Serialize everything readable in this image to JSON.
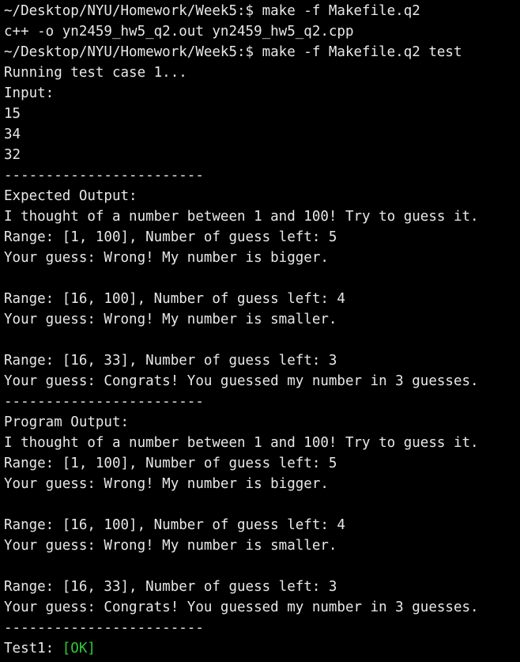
{
  "terminal": {
    "lines": [
      "~/Desktop/NYU/Homework/Week5:$ make -f Makefile.q2",
      "c++ -o yn2459_hw5_q2.out yn2459_hw5_q2.cpp",
      "~/Desktop/NYU/Homework/Week5:$ make -f Makefile.q2 test",
      "Running test case 1...",
      "Input:",
      "15",
      "34",
      "32",
      "------------------------",
      "Expected Output:",
      "I thought of a number between 1 and 100! Try to guess it.",
      "Range: [1, 100], Number of guess left: 5",
      "Your guess: Wrong! My number is bigger.",
      "",
      "Range: [16, 100], Number of guess left: 4",
      "Your guess: Wrong! My number is smaller.",
      "",
      "Range: [16, 33], Number of guess left: 3",
      "Your guess: Congrats! You guessed my number in 3 guesses.",
      "------------------------",
      "Program Output:",
      "I thought of a number between 1 and 100! Try to guess it.",
      "Range: [1, 100], Number of guess left: 5",
      "Your guess: Wrong! My number is bigger.",
      "",
      "Range: [16, 100], Number of guess left: 4",
      "Your guess: Wrong! My number is smaller.",
      "",
      "Range: [16, 33], Number of guess left: 3",
      "Your guess: Congrats! You guessed my number in 3 guesses.",
      "------------------------"
    ],
    "final_line": {
      "prefix": "Test1: ",
      "status": "[OK]"
    },
    "colors": {
      "background": "#000000",
      "text": "#e8e8e8",
      "ok": "#31c93c"
    }
  }
}
